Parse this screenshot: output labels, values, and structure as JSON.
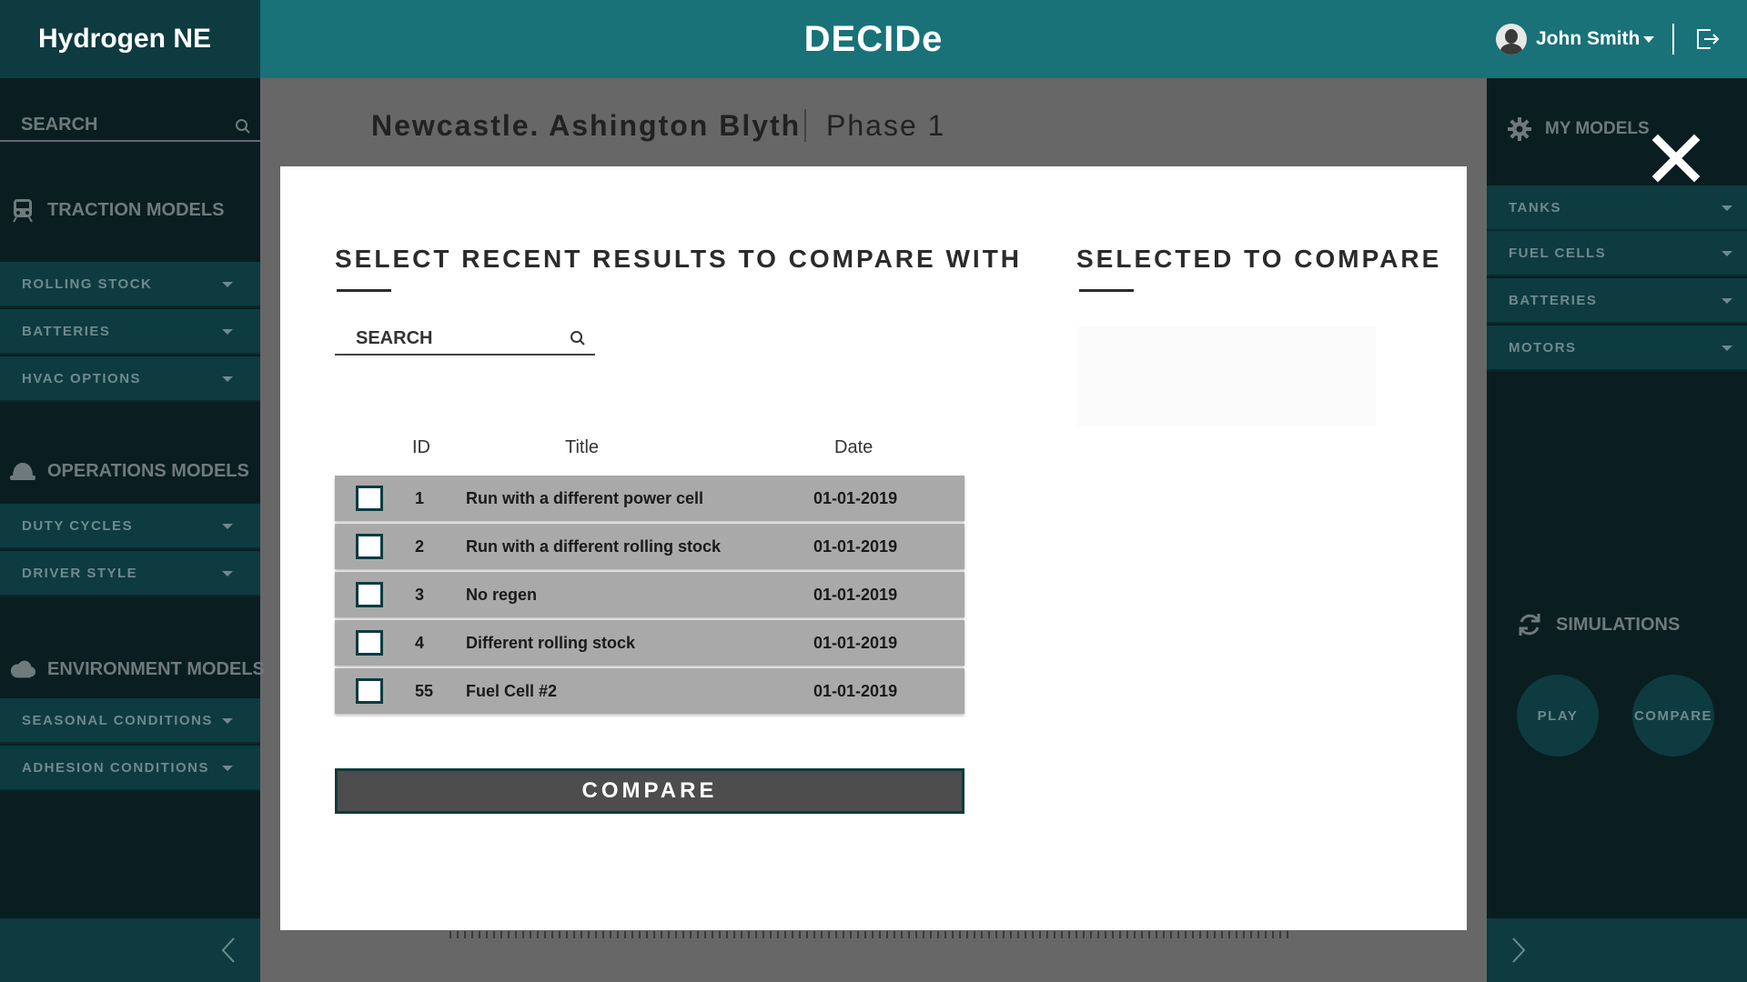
{
  "brand": "Hydrogen NE",
  "app_title": "DECIDe",
  "user": {
    "name": "John Smith"
  },
  "page": {
    "title": "Newcastle. Ashington Blyth",
    "phase": "Phase 1"
  },
  "left_sidebar": {
    "search_label": "SEARCH",
    "sections": [
      {
        "title": "TRACTION MODELS",
        "items": [
          "ROLLING STOCK",
          "BATTERIES",
          "HVAC OPTIONS"
        ]
      },
      {
        "title": "OPERATIONS MODELS",
        "items": [
          "DUTY CYCLES",
          "DRIVER STYLE"
        ]
      },
      {
        "title": "ENVIRONMENT MODELS",
        "items": [
          "SEASONAL CONDITIONS",
          "ADHESION CONDITIONS"
        ]
      }
    ]
  },
  "right_sidebar": {
    "my_models_label": "MY MODELS",
    "items": [
      "TANKS",
      "FUEL CELLS",
      "BATTERIES",
      "MOTORS"
    ],
    "simulations_label": "SIMULATIONS",
    "play_label": "PLAY",
    "compare_label": "COMPARE"
  },
  "modal": {
    "left_heading": "SELECT RECENT RESULTS TO COMPARE WITH",
    "right_heading": "SELECTED TO COMPARE",
    "search_label": "SEARCH",
    "columns": {
      "id": "ID",
      "title": "Title",
      "date": "Date"
    },
    "rows": [
      {
        "id": "1",
        "title": "Run with a different power cell",
        "date": "01-01-2019",
        "checked": false
      },
      {
        "id": "2",
        "title": "Run with a different rolling stock",
        "date": "01-01-2019",
        "checked": false
      },
      {
        "id": "3",
        "title": "No regen",
        "date": "01-01-2019",
        "checked": false
      },
      {
        "id": "4",
        "title": "Different rolling stock",
        "date": "01-01-2019",
        "checked": false
      },
      {
        "id": "55",
        "title": "Fuel Cell #2",
        "date": "01-01-2019",
        "checked": false
      }
    ],
    "compare_button": "COMPARE"
  },
  "colors": {
    "header_teal": "#187278",
    "sidebar_dark": "#0a1e21",
    "item_teal": "#0d3b40",
    "overlay_gray": "#676767",
    "row_gray": "#a9a9a9",
    "button_gray": "#4d4d4d"
  },
  "icons": [
    "search-icon",
    "train-icon",
    "hard-hat-icon",
    "cloud-icon",
    "gear-icon",
    "refresh-icon",
    "close-icon",
    "logout-icon",
    "chevron-left-icon",
    "chevron-right-icon",
    "avatar-icon"
  ]
}
